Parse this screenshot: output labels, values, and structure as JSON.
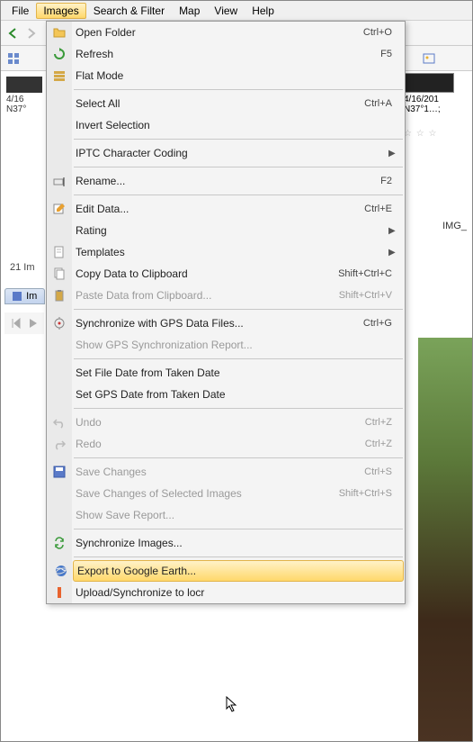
{
  "menubar": {
    "items": [
      "File",
      "Images",
      "Search & Filter",
      "Map",
      "View",
      "Help"
    ],
    "open_index": 1
  },
  "left": {
    "date": "4/16",
    "coord": "N37°"
  },
  "right_thumb": {
    "date": "4/16/201",
    "coord": "N37°1…;",
    "stars": "☆ ☆ ☆",
    "file": "IMG_"
  },
  "status": "21 Im",
  "tab": {
    "label": "Im"
  },
  "menu": [
    {
      "label": "Open Folder",
      "shortcut": "Ctrl+O",
      "icon": "folder-icon"
    },
    {
      "label": "Refresh",
      "shortcut": "F5",
      "icon": "refresh-icon"
    },
    {
      "label": "Flat Mode",
      "icon": "flat-icon"
    },
    {
      "sep": true
    },
    {
      "label": "Select All",
      "shortcut": "Ctrl+A"
    },
    {
      "label": "Invert Selection"
    },
    {
      "sep": true
    },
    {
      "label": "IPTC Character Coding",
      "submenu": true
    },
    {
      "sep": true
    },
    {
      "label": "Rename...",
      "shortcut": "F2",
      "icon": "rename-icon"
    },
    {
      "sep": true
    },
    {
      "label": "Edit Data...",
      "shortcut": "Ctrl+E",
      "icon": "edit-icon"
    },
    {
      "label": "Rating",
      "submenu": true
    },
    {
      "label": "Templates",
      "submenu": true,
      "icon": "template-icon"
    },
    {
      "label": "Copy Data to Clipboard",
      "shortcut": "Shift+Ctrl+C",
      "icon": "copy-icon"
    },
    {
      "label": "Paste Data from Clipboard...",
      "shortcut": "Shift+Ctrl+V",
      "disabled": true,
      "icon": "paste-icon"
    },
    {
      "sep": true
    },
    {
      "label": "Synchronize with GPS Data Files...",
      "shortcut": "Ctrl+G",
      "icon": "gps-icon"
    },
    {
      "label": "Show GPS Synchronization Report...",
      "disabled": true
    },
    {
      "sep": true
    },
    {
      "label": "Set File Date from Taken Date"
    },
    {
      "label": "Set GPS Date from Taken Date"
    },
    {
      "sep": true
    },
    {
      "label": "Undo",
      "shortcut": "Ctrl+Z",
      "disabled": true,
      "icon": "undo-icon"
    },
    {
      "label": "Redo",
      "shortcut": "Ctrl+Z",
      "disabled": true,
      "icon": "redo-icon"
    },
    {
      "sep": true
    },
    {
      "label": "Save Changes",
      "shortcut": "Ctrl+S",
      "disabled": true,
      "icon": "save-icon"
    },
    {
      "label": "Save Changes of Selected Images",
      "shortcut": "Shift+Ctrl+S",
      "disabled": true
    },
    {
      "label": "Show Save Report...",
      "disabled": true
    },
    {
      "sep": true
    },
    {
      "label": "Synchronize Images...",
      "icon": "sync-icon"
    },
    {
      "sep": true
    },
    {
      "label": "Export to Google Earth...",
      "icon": "earth-icon",
      "hover": true
    },
    {
      "label": "Upload/Synchronize to locr",
      "icon": "locr-icon"
    }
  ]
}
